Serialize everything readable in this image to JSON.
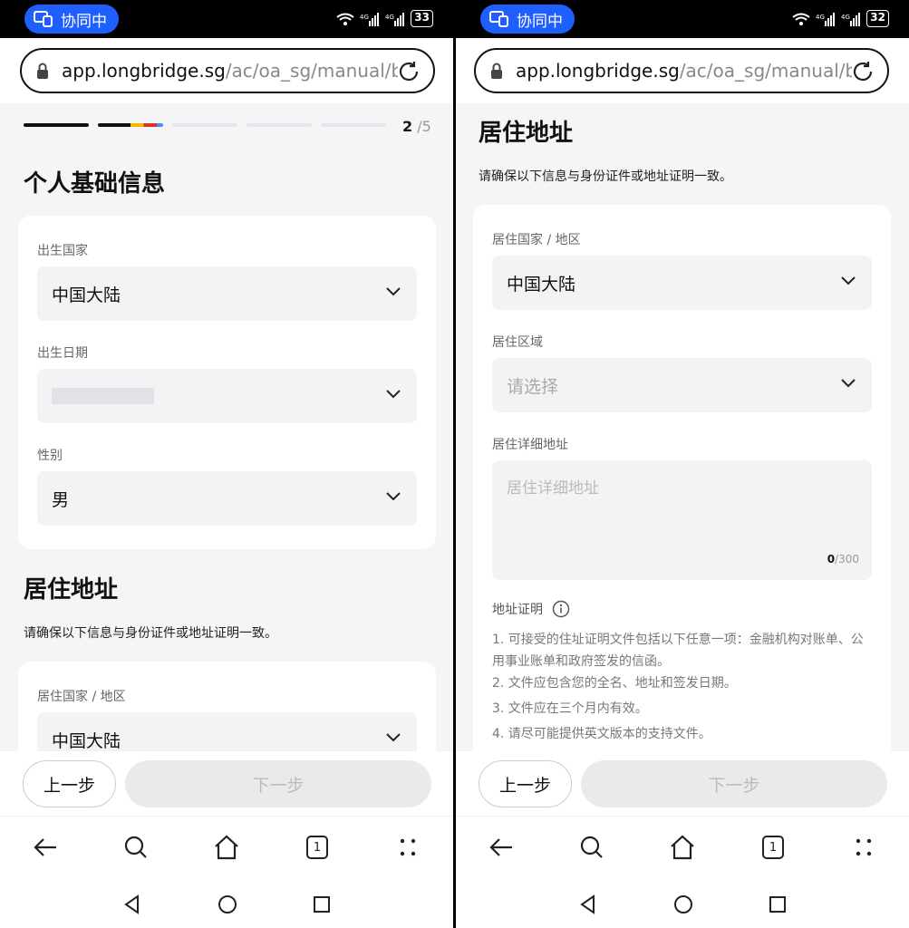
{
  "status": {
    "collab_label": "协同中",
    "signal": "4G",
    "battery_left": "33",
    "battery_right": "32"
  },
  "browser": {
    "url_host": "app.longbridge.sg",
    "url_path": "/ac/oa_sg/manual/b",
    "tab_count": "1"
  },
  "progress": {
    "current": "2",
    "total": "/5"
  },
  "personal": {
    "title": "个人基础信息",
    "birth_country_label": "出生国家",
    "birth_country_value": "中国大陆",
    "birth_date_label": "出生日期",
    "gender_label": "性别",
    "gender_value": "男"
  },
  "residence": {
    "title": "居住地址",
    "subtitle": "请确保以下信息与身份证件或地址证明一致。",
    "country_label": "居住国家 / 地区",
    "country_value": "中国大陆",
    "region_label": "居住区域",
    "region_placeholder": "请选择",
    "detail_label": "居住详细地址",
    "detail_placeholder": "居住详细地址",
    "detail_count": "0",
    "detail_max": "/300",
    "proof_label": "地址证明",
    "notes": [
      "1. 可接受的住址证明文件包括以下任意一项：金融机构对账单、公用事业账单和政府签发的信函。",
      "2. 文件应包含您的全名、地址和签发日期。",
      "3. 文件应在三个月内有效。",
      "4. 请尽可能提供英文版本的支持文件。"
    ]
  },
  "actions": {
    "prev_label": "上一步",
    "next_label": "下一步"
  },
  "colors": {
    "accent": "#1f5fff",
    "progress_done": "#111111",
    "disabled_button": "#e9eaec"
  }
}
